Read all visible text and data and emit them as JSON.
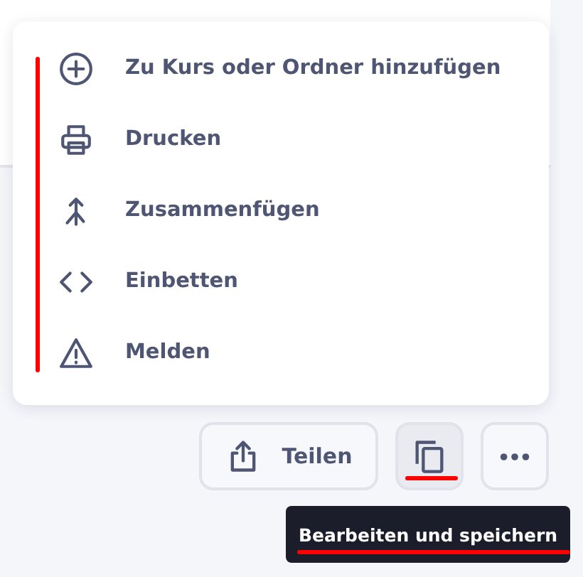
{
  "menu": {
    "items": [
      {
        "kind": "add",
        "label": "Zu Kurs oder Ordner hinzufügen"
      },
      {
        "kind": "print",
        "label": "Drucken"
      },
      {
        "kind": "merge",
        "label": "Zusammenfügen"
      },
      {
        "kind": "embed",
        "label": "Einbetten"
      },
      {
        "kind": "report",
        "label": "Melden"
      }
    ]
  },
  "toolbar": {
    "share_label": "Teilen",
    "copy_hovered": true
  },
  "tooltip": {
    "text": "Bearbeiten und speichern"
  }
}
